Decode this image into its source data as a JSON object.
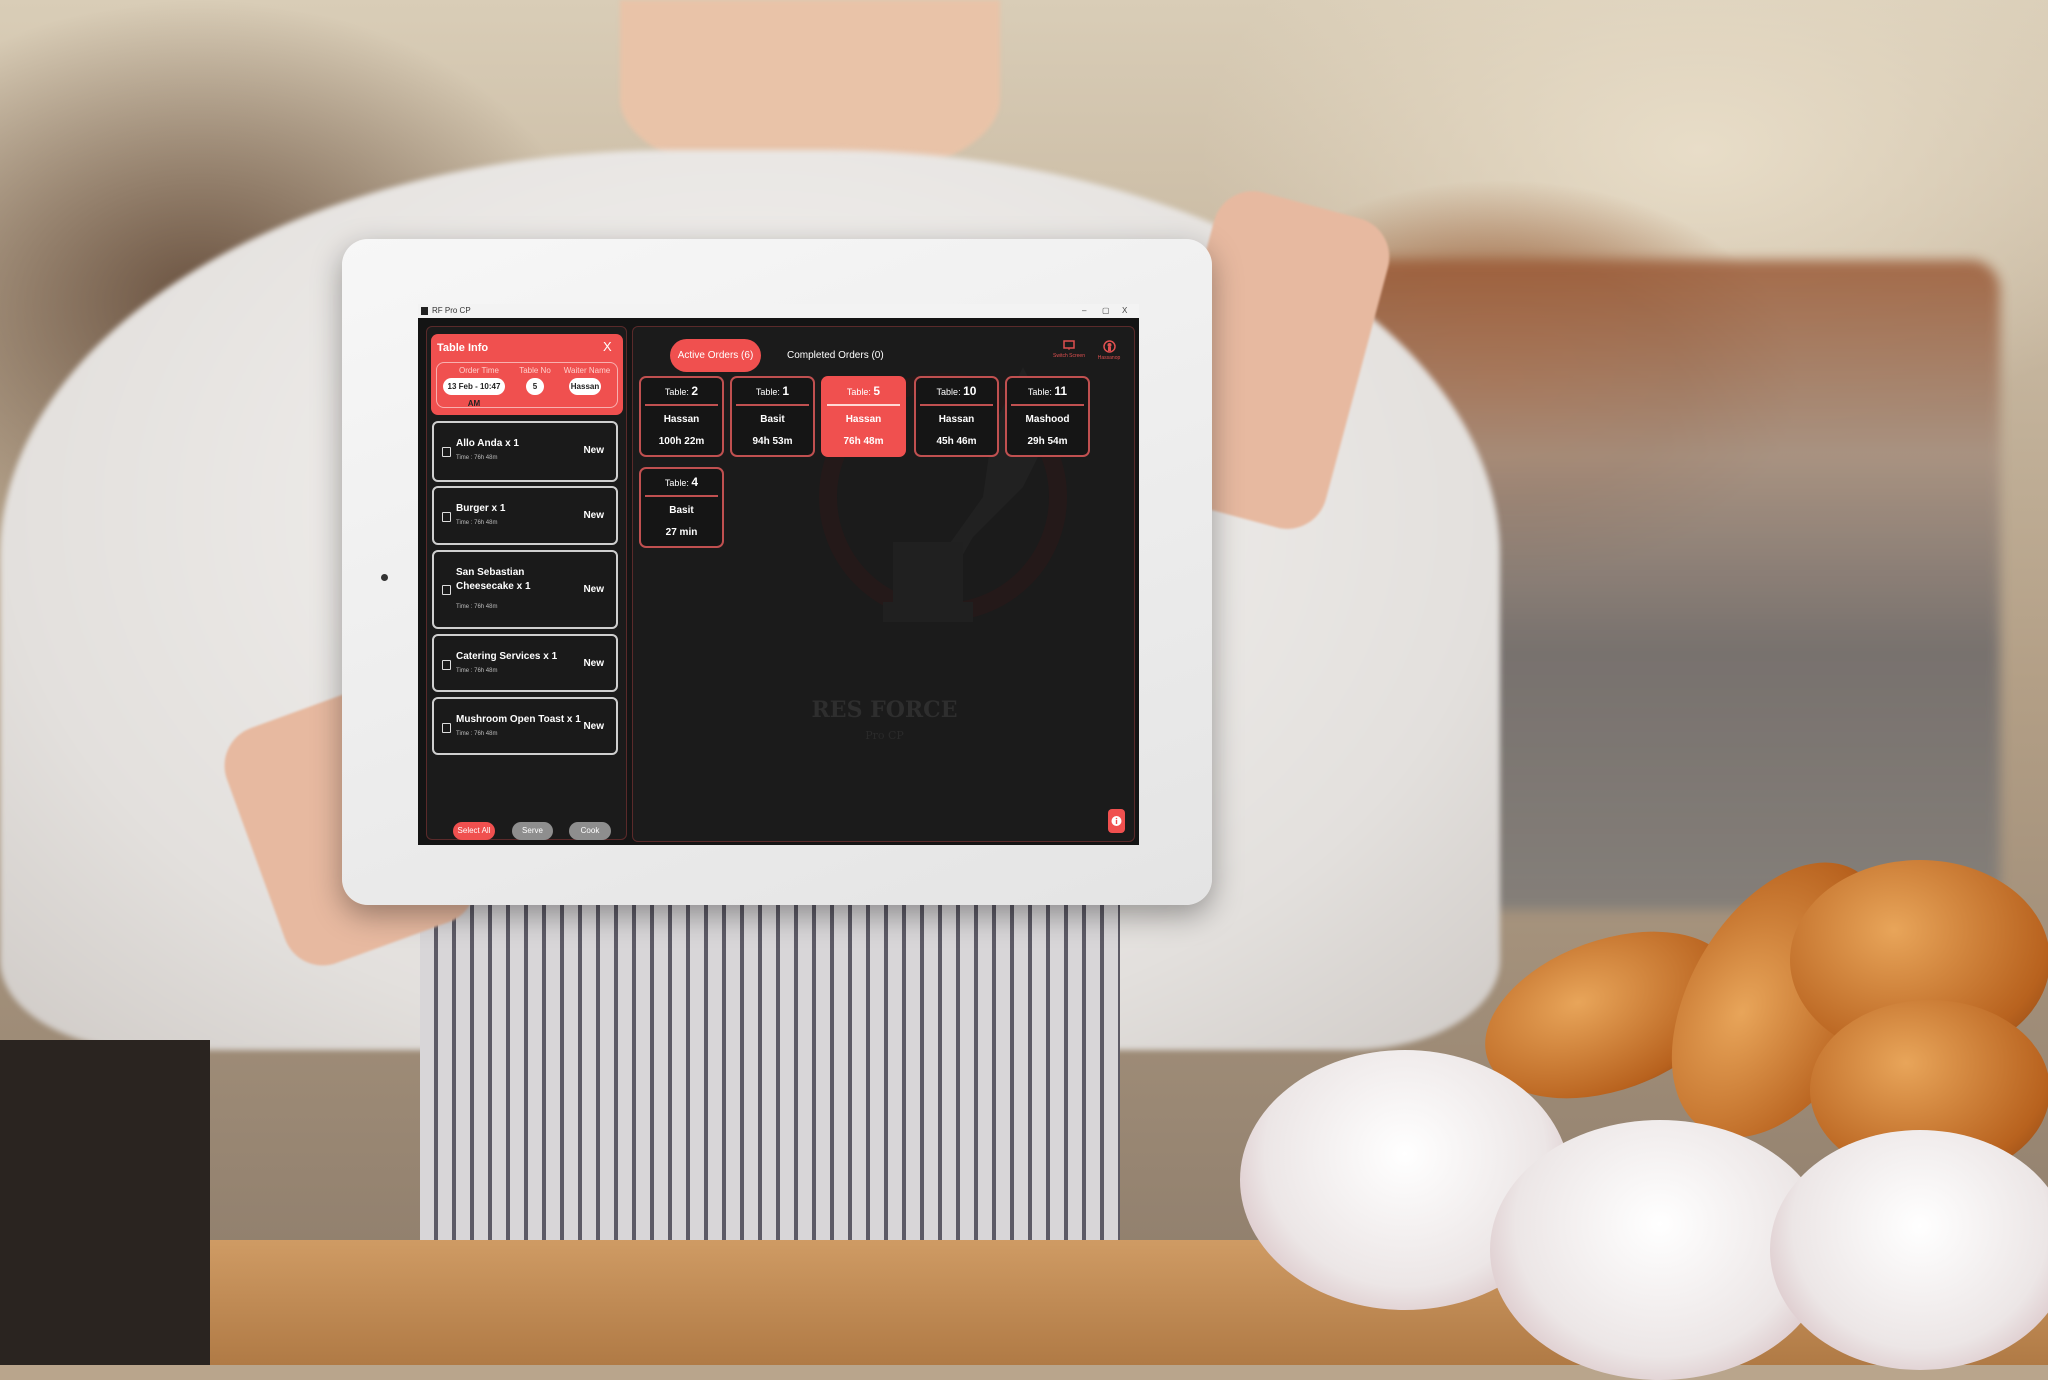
{
  "window": {
    "title": "RF Pro CP",
    "controls": [
      "–",
      "▢",
      "X"
    ]
  },
  "table_info": {
    "title": "Table Info",
    "close_label": "X",
    "order_time_label": "Order Time",
    "order_time": "13 Feb - 10:47 AM",
    "table_no_label": "Table No",
    "table_no": "5",
    "waiter_name_label": "Waiter Name",
    "waiter_name": "Hassan"
  },
  "items": [
    {
      "name": "Allo Anda x 1",
      "time": "Time : 76h 48m",
      "status": "New"
    },
    {
      "name": "Burger x 1",
      "time": "Time : 76h 48m",
      "status": "New"
    },
    {
      "name": "San Sebastian Cheesecake x 1",
      "time": "Time : 76h 48m",
      "status": "New"
    },
    {
      "name": "Catering Services x 1",
      "time": "Time : 76h 48m",
      "status": "New"
    },
    {
      "name": "Mushroom Open Toast x 1",
      "time": "Time : 76h 48m",
      "status": "New"
    }
  ],
  "actions": {
    "select_all": "Select All",
    "serve": "Serve",
    "cook": "Cook"
  },
  "tabs": {
    "active": "Active Orders (6)",
    "completed": "Completed Orders (0)"
  },
  "header_icons": {
    "switch_screen": "Switch Screen",
    "user": "Hassanop"
  },
  "table_prefix": "Table:",
  "orders": [
    {
      "table": "2",
      "waiter": "Hassan",
      "duration": "100h 22m",
      "selected": false
    },
    {
      "table": "1",
      "waiter": "Basit",
      "duration": "94h 53m",
      "selected": false
    },
    {
      "table": "5",
      "waiter": "Hassan",
      "duration": "76h 48m",
      "selected": true
    },
    {
      "table": "10",
      "waiter": "Hassan",
      "duration": "45h 46m",
      "selected": false
    },
    {
      "table": "11",
      "waiter": "Mashood",
      "duration": "29h 54m",
      "selected": false
    },
    {
      "table": "4",
      "waiter": "Basit",
      "duration": "27 min",
      "selected": false
    }
  ],
  "watermark": {
    "title": "RES FORCE",
    "subtitle": "Pro CP"
  },
  "colors": {
    "accent": "#f0504f",
    "background": "#141414",
    "card_border": "#c05050"
  }
}
